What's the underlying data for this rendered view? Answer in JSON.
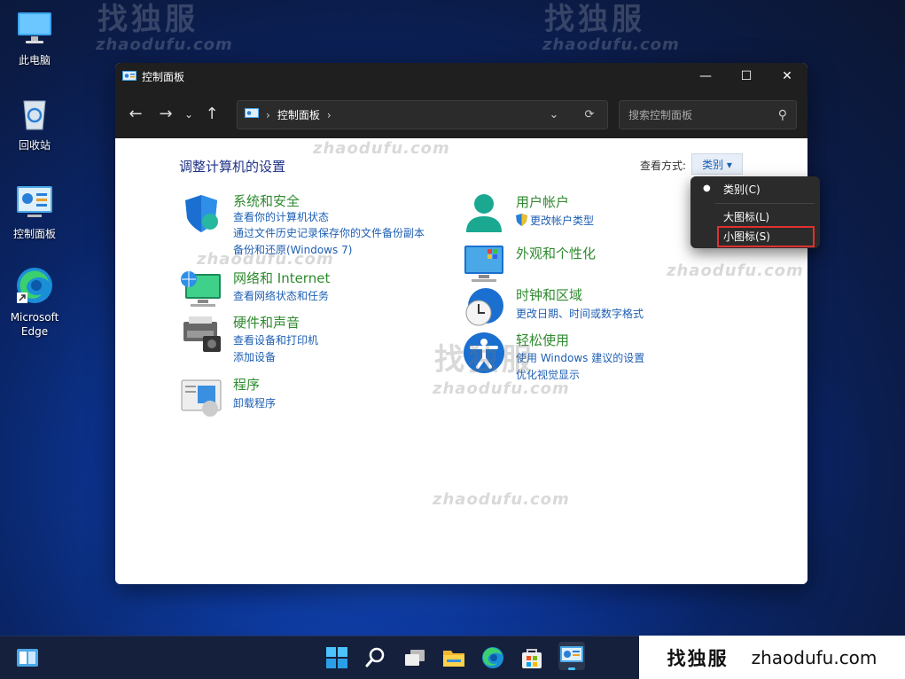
{
  "watermark": {
    "cn": "找独服",
    "url": "zhaodufu.com"
  },
  "desktop": {
    "icons": [
      {
        "label": "此电脑",
        "icon": "monitor-icon"
      },
      {
        "label": "回收站",
        "icon": "recycle-bin-icon"
      },
      {
        "label": "控制面板",
        "icon": "control-panel-icon"
      },
      {
        "label": "Microsoft\nEdge",
        "icon": "edge-icon"
      }
    ]
  },
  "window": {
    "title": "控制面板",
    "controls": {
      "minimize": "—",
      "maximize": "☐",
      "close": "✕"
    },
    "address": {
      "segment": "控制面板"
    },
    "search": {
      "placeholder": "搜索控制面板"
    },
    "heading": "调整计算机的设置",
    "view_by_label": "查看方式:",
    "view_by_value": "类别 ▾",
    "categories": [
      {
        "title": "系统和安全",
        "links": [
          "查看你的计算机状态",
          "通过文件历史记录保存你的文件备份副本",
          "备份和还原(Windows 7)"
        ],
        "icon": "shield-icon"
      },
      {
        "title": "网络和 Internet",
        "links": [
          "查看网络状态和任务"
        ],
        "icon": "network-icon"
      },
      {
        "title": "硬件和声音",
        "links": [
          "查看设备和打印机",
          "添加设备"
        ],
        "icon": "printer-icon"
      },
      {
        "title": "程序",
        "links": [
          "卸载程序"
        ],
        "icon": "programs-icon"
      },
      {
        "title": "用户帐户",
        "links": [
          "更改帐户类型"
        ],
        "icon": "user-icon"
      },
      {
        "title": "外观和个性化",
        "links": [],
        "icon": "appearance-icon"
      },
      {
        "title": "时钟和区域",
        "links": [
          "更改日期、时间或数字格式"
        ],
        "icon": "clock-icon"
      },
      {
        "title": "轻松使用",
        "links": [
          "使用 Windows 建议的设置",
          "优化视觉显示"
        ],
        "icon": "accessibility-icon"
      }
    ]
  },
  "view_menu": {
    "items": [
      "类别(C)",
      "大图标(L)",
      "小图标(S)"
    ],
    "selected": "类别(C)",
    "highlighted": "小图标(S)"
  },
  "brand": {
    "cn": "找独服",
    "url": "zhaodufu.com"
  },
  "colors": {
    "accent": "#1e5fb4",
    "category_title": "#2e8b2e",
    "heading": "#1e3287",
    "highlight_box": "#e03030"
  }
}
